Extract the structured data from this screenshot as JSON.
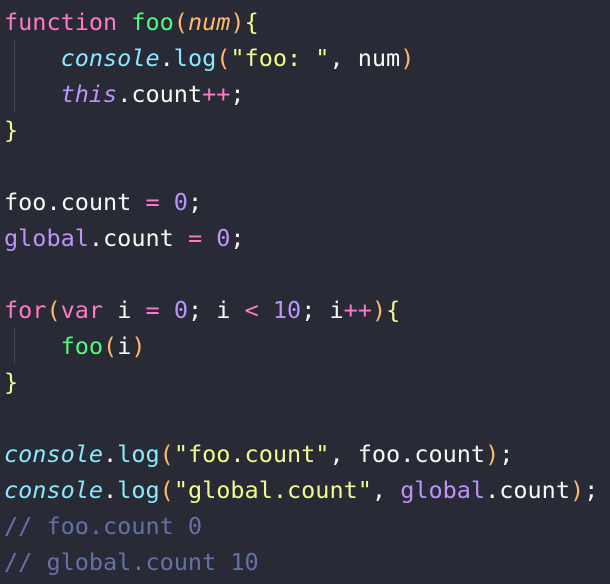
{
  "editor": {
    "theme": {
      "background": "#282a36",
      "colors": {
        "keyword": "#ff79c6",
        "func": "#50fa7b",
        "param": "#ffb86c",
        "builtin": "#8be9fd",
        "string": "#f1fa8c",
        "number": "#bd93f9",
        "global": "#bd93f9",
        "op": "#ff79c6",
        "punct": "#f8f8f2",
        "brace": "#f1fa8c",
        "comment": "#6272a4",
        "plain": "#f8f8f2"
      }
    },
    "lines": [
      {
        "guide": false,
        "tokens": [
          {
            "t": "function",
            "c": "keyword"
          },
          {
            "t": " ",
            "c": "plain"
          },
          {
            "t": "foo",
            "c": "func"
          },
          {
            "t": "(",
            "c": "param"
          },
          {
            "t": "num",
            "c": "param",
            "i": true
          },
          {
            "t": ")",
            "c": "param"
          },
          {
            "t": "{",
            "c": "brace"
          }
        ]
      },
      {
        "guide": true,
        "tokens": [
          {
            "t": "    ",
            "c": "plain"
          },
          {
            "t": "console",
            "c": "builtin",
            "i": true
          },
          {
            "t": ".",
            "c": "punct"
          },
          {
            "t": "log",
            "c": "builtin"
          },
          {
            "t": "(",
            "c": "param"
          },
          {
            "t": "\"foo: \"",
            "c": "string"
          },
          {
            "t": ", num",
            "c": "plain"
          },
          {
            "t": ")",
            "c": "param"
          }
        ]
      },
      {
        "guide": true,
        "tokens": [
          {
            "t": "    ",
            "c": "plain"
          },
          {
            "t": "this",
            "c": "number",
            "i": true
          },
          {
            "t": ".count",
            "c": "plain"
          },
          {
            "t": "++",
            "c": "op"
          },
          {
            "t": ";",
            "c": "plain"
          }
        ]
      },
      {
        "guide": false,
        "tokens": [
          {
            "t": "}",
            "c": "brace"
          }
        ]
      },
      {
        "guide": false,
        "tokens": []
      },
      {
        "guide": false,
        "tokens": [
          {
            "t": "foo.count ",
            "c": "plain"
          },
          {
            "t": "=",
            "c": "op"
          },
          {
            "t": " ",
            "c": "plain"
          },
          {
            "t": "0",
            "c": "number"
          },
          {
            "t": ";",
            "c": "plain"
          }
        ]
      },
      {
        "guide": false,
        "tokens": [
          {
            "t": "global",
            "c": "global"
          },
          {
            "t": ".count ",
            "c": "plain"
          },
          {
            "t": "=",
            "c": "op"
          },
          {
            "t": " ",
            "c": "plain"
          },
          {
            "t": "0",
            "c": "number"
          },
          {
            "t": ";",
            "c": "plain"
          }
        ]
      },
      {
        "guide": false,
        "tokens": []
      },
      {
        "guide": false,
        "tokens": [
          {
            "t": "for",
            "c": "keyword"
          },
          {
            "t": "(",
            "c": "param"
          },
          {
            "t": "var",
            "c": "keyword"
          },
          {
            "t": " i ",
            "c": "plain"
          },
          {
            "t": "=",
            "c": "op"
          },
          {
            "t": " ",
            "c": "plain"
          },
          {
            "t": "0",
            "c": "number"
          },
          {
            "t": "; i ",
            "c": "plain"
          },
          {
            "t": "<",
            "c": "op"
          },
          {
            "t": " ",
            "c": "plain"
          },
          {
            "t": "10",
            "c": "number"
          },
          {
            "t": "; i",
            "c": "plain"
          },
          {
            "t": "++",
            "c": "op"
          },
          {
            "t": ")",
            "c": "param"
          },
          {
            "t": "{",
            "c": "brace"
          }
        ]
      },
      {
        "guide": true,
        "tokens": [
          {
            "t": "    ",
            "c": "plain"
          },
          {
            "t": "foo",
            "c": "func"
          },
          {
            "t": "(",
            "c": "param"
          },
          {
            "t": "i",
            "c": "plain"
          },
          {
            "t": ")",
            "c": "param"
          }
        ]
      },
      {
        "guide": false,
        "tokens": [
          {
            "t": "}",
            "c": "brace"
          }
        ]
      },
      {
        "guide": false,
        "tokens": []
      },
      {
        "guide": false,
        "tokens": [
          {
            "t": "console",
            "c": "builtin",
            "i": true
          },
          {
            "t": ".",
            "c": "punct"
          },
          {
            "t": "log",
            "c": "builtin"
          },
          {
            "t": "(",
            "c": "param"
          },
          {
            "t": "\"foo.count\"",
            "c": "string"
          },
          {
            "t": ", foo.count",
            "c": "plain"
          },
          {
            "t": ")",
            "c": "param"
          },
          {
            "t": ";",
            "c": "plain"
          }
        ]
      },
      {
        "guide": false,
        "tokens": [
          {
            "t": "console",
            "c": "builtin",
            "i": true
          },
          {
            "t": ".",
            "c": "punct"
          },
          {
            "t": "log",
            "c": "builtin"
          },
          {
            "t": "(",
            "c": "param"
          },
          {
            "t": "\"global.count\"",
            "c": "string"
          },
          {
            "t": ", ",
            "c": "plain"
          },
          {
            "t": "global",
            "c": "global"
          },
          {
            "t": ".count",
            "c": "plain"
          },
          {
            "t": ")",
            "c": "param"
          },
          {
            "t": ";",
            "c": "plain"
          }
        ]
      },
      {
        "guide": false,
        "tokens": [
          {
            "t": "// foo.count 0",
            "c": "comment"
          }
        ]
      },
      {
        "guide": false,
        "tokens": [
          {
            "t": "// global.count 10",
            "c": "comment"
          }
        ]
      }
    ]
  }
}
